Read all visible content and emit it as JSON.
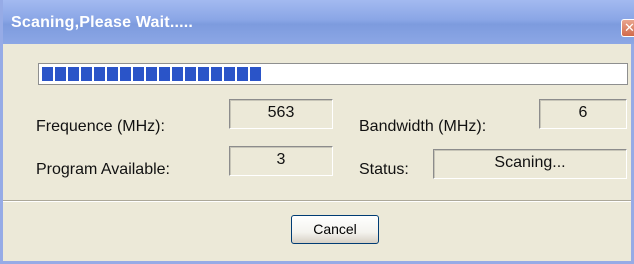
{
  "window": {
    "title": "Scaning,Please Wait.....",
    "close_symbol": "✕"
  },
  "progress": {
    "value_fraction": 0.39,
    "fill_color": "#2a54c8"
  },
  "fields": {
    "frequence": {
      "label": "Frequence (MHz):",
      "value": "563"
    },
    "bandwidth": {
      "label": "Bandwidth (MHz):",
      "value": "6"
    },
    "program_available": {
      "label": "Program Available:",
      "value": "3"
    },
    "status": {
      "label": "Status:",
      "value": "Scaning..."
    }
  },
  "buttons": {
    "cancel_label": "Cancel"
  },
  "colors": {
    "titlebar": "#8aa6e6",
    "dialog_bg": "#ece9d8",
    "close_button": "#d26a4b"
  },
  "icons": {
    "close": "close-icon"
  }
}
